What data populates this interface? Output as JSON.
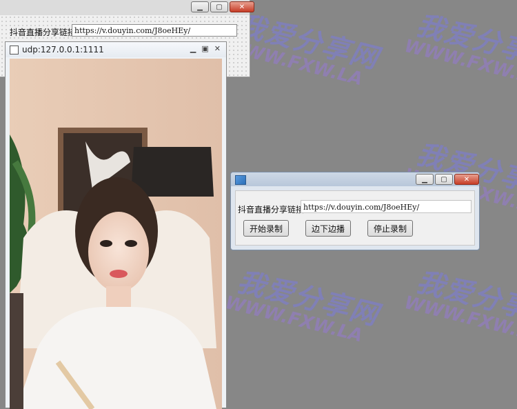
{
  "designer_window": {
    "link_label": "抖音直播分享链接：",
    "link_value": "https://v.douyin.com/J8oeHEy/"
  },
  "video_window": {
    "title": "udp:127.0.0.1:1111"
  },
  "app_window": {
    "link_label": "抖音直播分享链接：",
    "link_value": "https://v.douyin.com/J8oeHEy/",
    "buttons": {
      "start": "开始录制",
      "record_while_playing": "边下边播",
      "stop": "停止录制"
    }
  },
  "watermark": {
    "text_cn": "我爱分享网",
    "text_en": "WWW.FXW.LA"
  },
  "colors": {
    "desktop": "#878787",
    "watermark": "#7a7adc",
    "close_button": "#c63c26"
  }
}
